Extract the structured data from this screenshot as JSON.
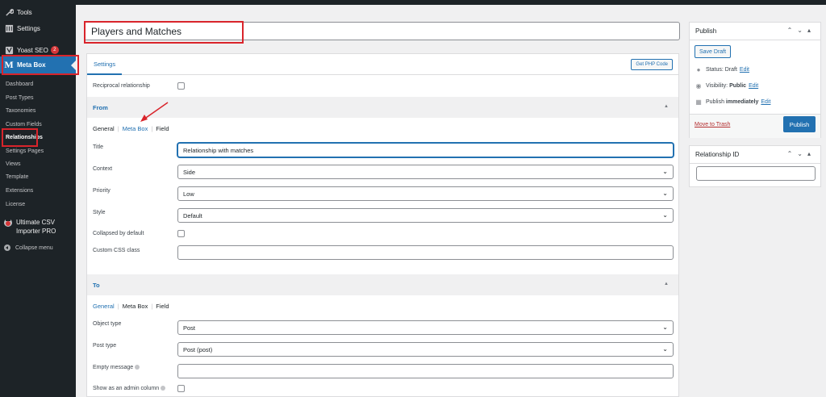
{
  "sidebar": {
    "top_items": [
      {
        "label": "Tools",
        "icon": "wrench-icon"
      },
      {
        "label": "Settings",
        "icon": "settings-sliders-icon"
      },
      {
        "label": "Yoast SEO",
        "icon": "yoast-icon",
        "badge": "2"
      },
      {
        "label": "Meta Box",
        "icon": "meta-box-icon"
      }
    ],
    "submenu": [
      "Dashboard",
      "Post Types",
      "Taxonomies",
      "Custom Fields",
      "Relationships",
      "Settings Pages",
      "Views",
      "Template",
      "Extensions",
      "License"
    ],
    "plugin": {
      "line1": "Ultimate CSV",
      "line2": "Importer PRO"
    },
    "collapse": "Collapse menu"
  },
  "editor": {
    "title": "Players and Matches"
  },
  "panel": {
    "tab": "Settings",
    "php_button": "Get PHP Code",
    "reciprocal_label": "Reciprocal relationship",
    "from": {
      "heading": "From",
      "subtabs": [
        "General",
        "Meta Box",
        "Field"
      ],
      "title_label": "Title",
      "title_value": "Relationship with matches",
      "context_label": "Context",
      "context_value": "Side",
      "priority_label": "Priority",
      "priority_value": "Low",
      "style_label": "Style",
      "style_value": "Default",
      "collapsed_label": "Collapsed by default",
      "css_label": "Custom CSS class"
    },
    "to": {
      "heading": "To",
      "subtabs": [
        "General",
        "Meta Box",
        "Field"
      ],
      "object_type_label": "Object type",
      "object_type_value": "Post",
      "post_type_label": "Post type",
      "post_type_value": "Post (post)",
      "empty_message_label": "Empty message",
      "admin_column_label": "Show as an admin column"
    }
  },
  "publish_box": {
    "title": "Publish",
    "save_draft": "Save Draft",
    "status_label": "Status:",
    "status_value": "Draft",
    "visibility_label": "Visibility:",
    "visibility_value": "Public",
    "publish_label": "Publish",
    "publish_value": "immediately",
    "edit": "Edit",
    "trash": "Move to Trash",
    "publish_button": "Publish"
  },
  "relationship_box": {
    "title": "Relationship ID"
  },
  "colors": {
    "accent": "#2271b1",
    "sidebar": "#1d2327",
    "highlight": "#d9242b"
  }
}
